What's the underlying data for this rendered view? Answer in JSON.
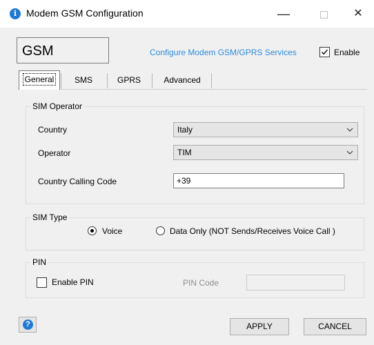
{
  "window": {
    "title": "Modem GSM Configuration",
    "icon": "info-icon",
    "controls": {
      "minimize": "—",
      "close": "✕"
    }
  },
  "header": {
    "service_name": "GSM",
    "configure_link": "Configure Modem GSM/GPRS Services",
    "enable_label": "Enable",
    "enable_checked": true
  },
  "tabs": [
    {
      "label": "General",
      "active": true
    },
    {
      "label": "SMS",
      "active": false
    },
    {
      "label": "GPRS",
      "active": false
    },
    {
      "label": "Advanced",
      "active": false
    }
  ],
  "sim_operator": {
    "title": "SIM Operator",
    "country_label": "Country",
    "country_value": "Italy",
    "operator_label": "Operator",
    "operator_value": "TIM",
    "calling_code_label": "Country Calling Code",
    "calling_code_value": "+39"
  },
  "sim_type": {
    "title": "SIM Type",
    "voice_label": "Voice",
    "data_only_label": "Data Only (NOT Sends/Receives Voice Call )",
    "selected": "voice"
  },
  "pin": {
    "title": "PIN",
    "enable_pin_label": "Enable PIN",
    "enable_pin_checked": false,
    "pin_code_label": "PIN Code",
    "pin_code_value": ""
  },
  "footer": {
    "help_icon": "question-icon",
    "help_glyph": "?",
    "apply_label": "APPLY",
    "cancel_label": "CANCEL"
  },
  "colors": {
    "accent": "#1f7ad6",
    "link": "#2b8be0",
    "dialog_bg": "#f0f0f0"
  }
}
